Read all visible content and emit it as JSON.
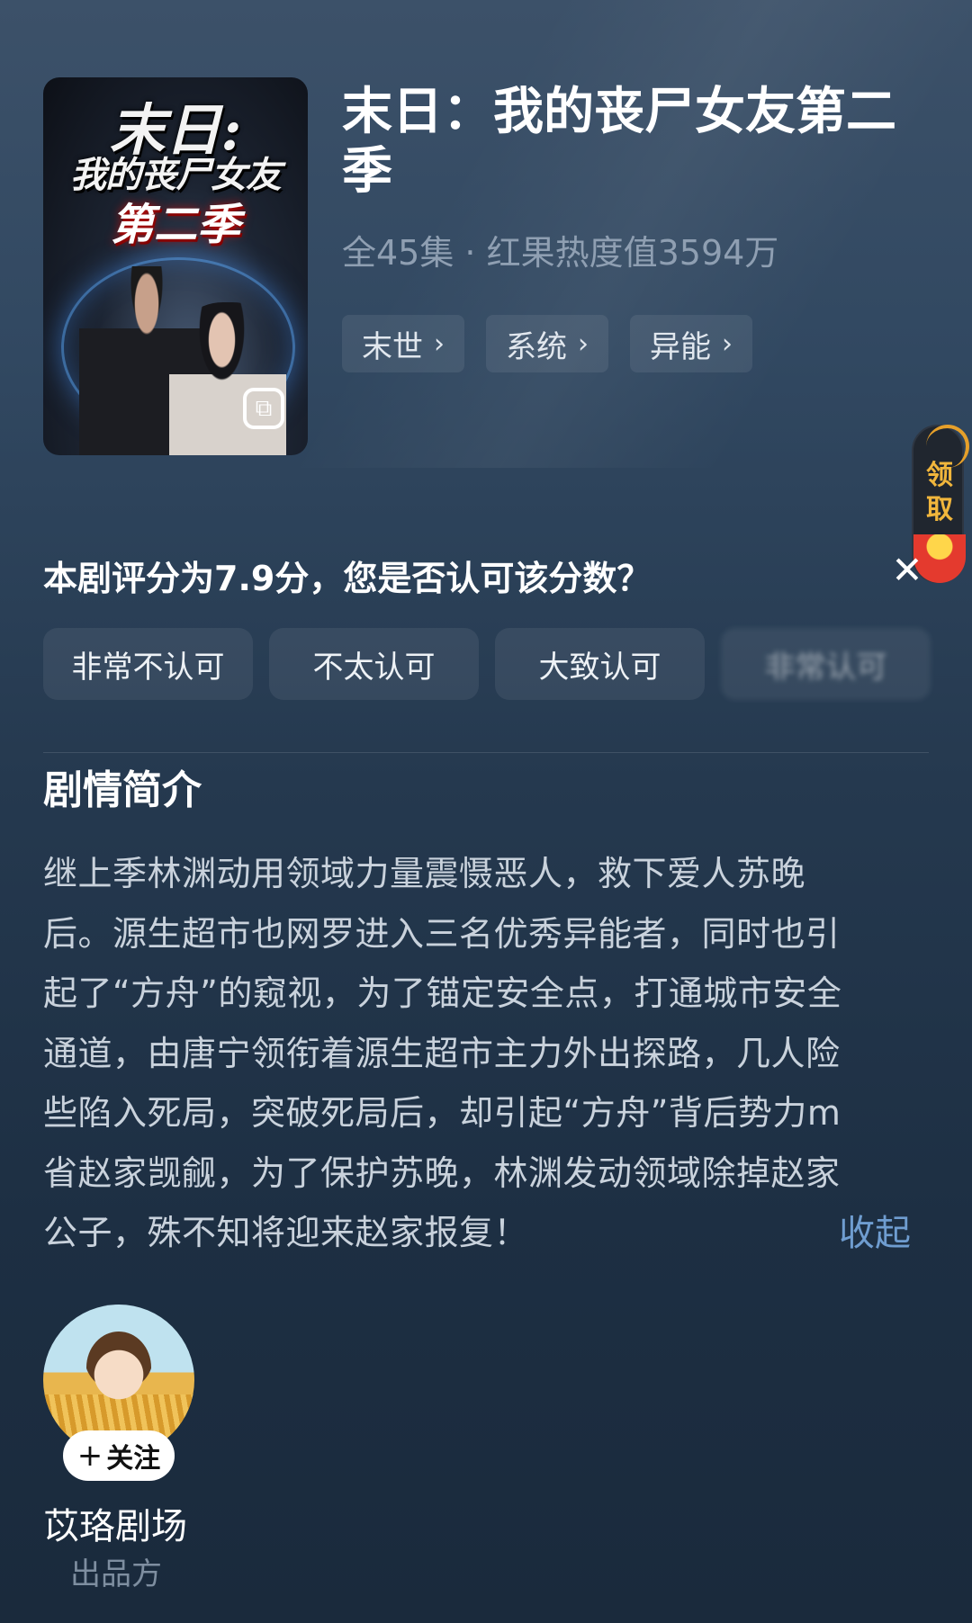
{
  "header": {
    "title": "末日：我的丧尸女友第二季",
    "meta": "全45集 · 红果热度值3594万",
    "poster": {
      "line1": "末日:",
      "line2": "我的丧尸女友",
      "line3": "第二季",
      "badge_icon": "cast-icon"
    },
    "tags": [
      {
        "label": "末世",
        "chevron": "›"
      },
      {
        "label": "系统",
        "chevron": "›"
      },
      {
        "label": "异能",
        "chevron": "›"
      }
    ]
  },
  "reward": {
    "label": "领取",
    "icon": "red-envelope-icon"
  },
  "rating": {
    "question": "本剧评分为7.9分，您是否认可该分数？",
    "close": "✕",
    "options": [
      "非常不认可",
      "不太认可",
      "大致认可",
      "非常认可"
    ]
  },
  "synopsis": {
    "heading": "剧情简介",
    "lines": [
      "继上季林渊动用领域力量震慑恶人，救下爱人苏晚",
      "后。源生超市也网罗进入三名优秀异能者，同时也引",
      "起了“方舟”的窥视，为了锚定安全点，打通城市安全",
      "通道，由唐宁领衔着源生超市主力外出探路，几人险",
      "些陷入死局，突破死局后，却引起“方舟”背后势力m",
      "省赵家觊觎，为了保护苏晚，林渊发动领域除掉赵家",
      "公子，殊不知将迎来赵家报复！"
    ],
    "collapse": "收起"
  },
  "producer": {
    "follow_plus": "+",
    "follow_label": "关注",
    "name": "苡珞剧场",
    "role": "出品方"
  }
}
